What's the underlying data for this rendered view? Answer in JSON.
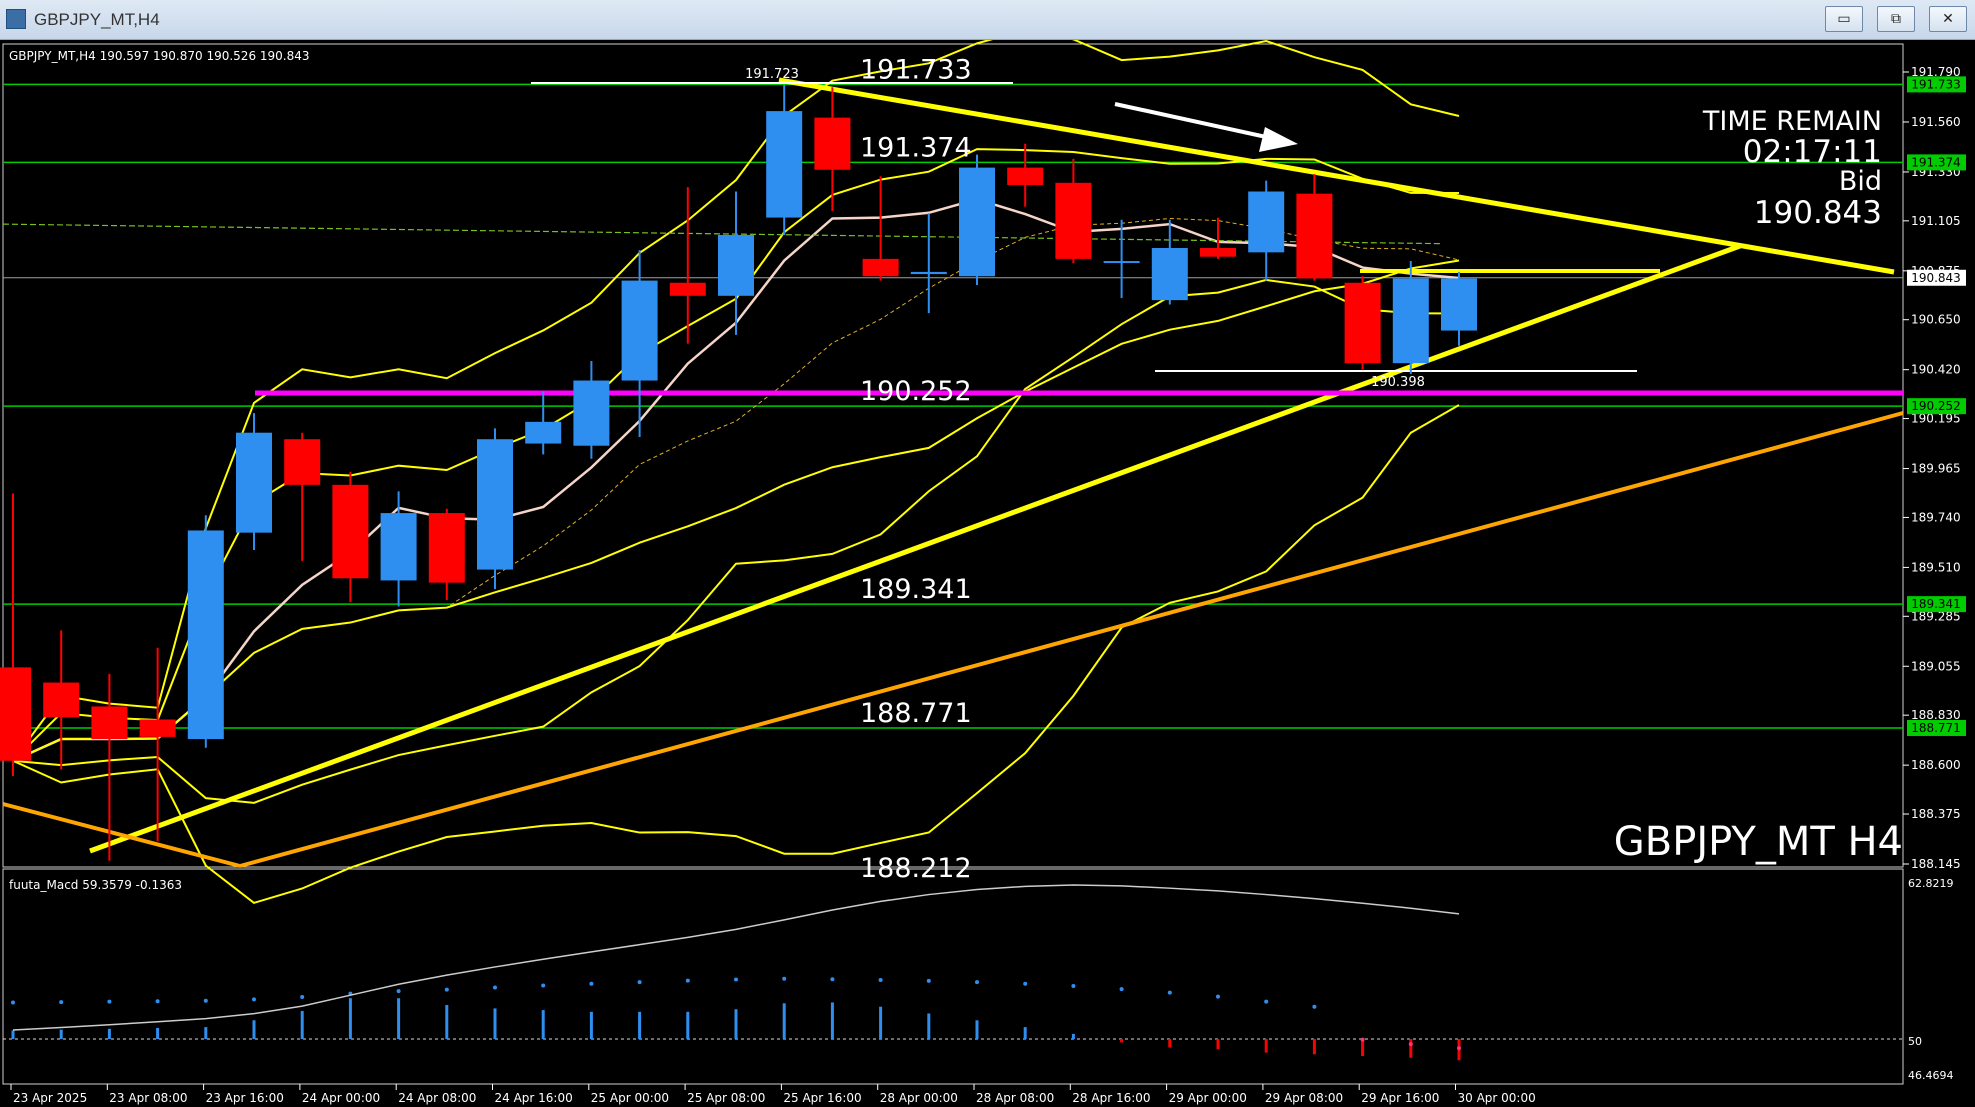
{
  "window": {
    "title": "GBPJPY_MT,H4",
    "buttons": {
      "minimize": "▭",
      "restore": "⧉",
      "close": "✕"
    }
  },
  "chart_info": {
    "header": "GBPJPY_MT,H4  190.597 190.870 190.526 190.843",
    "symbol_label": "GBPJPY_MT H4",
    "time_remain_label": "TIME REMAIN",
    "time_remain_value": "02:17:11",
    "bid_label": "Bid",
    "bid_value": "190.843"
  },
  "colors": {
    "background": "#000000",
    "bull": "#2e8ff0",
    "bear": "#ff0000",
    "trendline": "#ffff00",
    "hline": "#00cc00",
    "magenta": "#ff00ff",
    "orange": "#ffa500"
  },
  "price_axis": {
    "ticks": [
      "191.790",
      "191.560",
      "191.330",
      "191.105",
      "190.875",
      "190.650",
      "190.420",
      "190.195",
      "189.965",
      "189.740",
      "189.510",
      "189.285",
      "189.055",
      "188.830",
      "188.600",
      "188.375",
      "188.145"
    ],
    "labels": [
      {
        "text": "191.733",
        "color": "#00cc00"
      },
      {
        "text": "191.374",
        "color": "#00cc00"
      },
      {
        "text": "190.843",
        "color": "#ffffff"
      },
      {
        "text": "190.252",
        "color": "#00cc00"
      },
      {
        "text": "189.341",
        "color": "#00cc00"
      },
      {
        "text": "188.771",
        "color": "#00cc00"
      }
    ]
  },
  "level_labels": [
    {
      "text": "191.733",
      "price": 191.733
    },
    {
      "text": "191.374",
      "price": 191.374
    },
    {
      "text": "190.252",
      "price": 190.252
    },
    {
      "text": "189.341",
      "price": 189.341
    },
    {
      "text": "188.771",
      "price": 188.771
    }
  ],
  "small_labels": [
    {
      "text": "191.723"
    },
    {
      "text": "190.398"
    }
  ],
  "annotation_texts": {
    "partial_level": "188.212"
  },
  "candles": [
    {
      "o": 189.05,
      "h": 189.85,
      "l": 188.55,
      "c": 188.62
    },
    {
      "o": 188.98,
      "h": 189.22,
      "l": 188.58,
      "c": 188.82
    },
    {
      "o": 188.87,
      "h": 189.02,
      "l": 188.16,
      "c": 188.72
    },
    {
      "o": 188.81,
      "h": 189.14,
      "l": 188.25,
      "c": 188.73
    },
    {
      "o": 188.72,
      "h": 189.75,
      "l": 188.68,
      "c": 189.68
    },
    {
      "o": 189.67,
      "h": 190.22,
      "l": 189.59,
      "c": 190.13
    },
    {
      "o": 190.1,
      "h": 190.13,
      "l": 189.54,
      "c": 189.89
    },
    {
      "o": 189.89,
      "h": 189.95,
      "l": 189.35,
      "c": 189.46
    },
    {
      "o": 189.45,
      "h": 189.86,
      "l": 189.33,
      "c": 189.76
    },
    {
      "o": 189.76,
      "h": 189.78,
      "l": 189.36,
      "c": 189.44
    },
    {
      "o": 189.5,
      "h": 190.15,
      "l": 189.41,
      "c": 190.1
    },
    {
      "o": 190.08,
      "h": 190.32,
      "l": 190.03,
      "c": 190.18
    },
    {
      "o": 190.07,
      "h": 190.46,
      "l": 190.01,
      "c": 190.37
    },
    {
      "o": 190.37,
      "h": 190.97,
      "l": 190.11,
      "c": 190.83
    },
    {
      "o": 190.82,
      "h": 191.26,
      "l": 190.54,
      "c": 190.76
    },
    {
      "o": 190.76,
      "h": 191.24,
      "l": 190.58,
      "c": 191.04
    },
    {
      "o": 191.12,
      "h": 191.73,
      "l": 191.04,
      "c": 191.61
    },
    {
      "o": 191.58,
      "h": 191.72,
      "l": 191.15,
      "c": 191.34
    },
    {
      "o": 190.93,
      "h": 191.31,
      "l": 190.83,
      "c": 190.85
    },
    {
      "o": 190.86,
      "h": 191.14,
      "l": 190.68,
      "c": 190.87
    },
    {
      "o": 190.85,
      "h": 191.41,
      "l": 190.81,
      "c": 191.35
    },
    {
      "o": 191.35,
      "h": 191.46,
      "l": 191.17,
      "c": 191.27
    },
    {
      "o": 191.28,
      "h": 191.39,
      "l": 190.91,
      "c": 190.93
    },
    {
      "o": 190.92,
      "h": 191.11,
      "l": 190.75,
      "c": 190.92
    },
    {
      "o": 190.74,
      "h": 191.11,
      "l": 190.72,
      "c": 190.98
    },
    {
      "o": 190.98,
      "h": 191.12,
      "l": 190.93,
      "c": 190.94
    },
    {
      "o": 190.96,
      "h": 191.29,
      "l": 190.83,
      "c": 191.24
    },
    {
      "o": 191.23,
      "h": 191.32,
      "l": 190.83,
      "c": 190.84
    },
    {
      "o": 190.82,
      "h": 190.85,
      "l": 190.42,
      "c": 190.45
    },
    {
      "o": 190.45,
      "h": 190.92,
      "l": 190.4,
      "c": 190.84
    },
    {
      "o": 190.6,
      "h": 190.87,
      "l": 190.53,
      "c": 190.84
    }
  ],
  "indicator": {
    "label": "fuuta_Macd 59.3579  -0.1363",
    "scale_top": "62.8219",
    "scale_mid": "50",
    "scale_bottom": "46.4694",
    "histogram": [
      0.1,
      0.11,
      0.12,
      0.13,
      0.14,
      0.22,
      0.33,
      0.48,
      0.48,
      0.4,
      0.36,
      0.34,
      0.32,
      0.32,
      0.32,
      0.35,
      0.42,
      0.43,
      0.38,
      0.3,
      0.22,
      0.14,
      0.06,
      -0.04,
      -0.1,
      -0.12,
      -0.16,
      -0.18,
      -0.2,
      -0.22,
      -0.25
    ]
  },
  "time_axis": [
    "23 Apr 2025",
    "23 Apr 08:00",
    "23 Apr 16:00",
    "24 Apr 00:00",
    "24 Apr 08:00",
    "24 Apr 16:00",
    "25 Apr 00:00",
    "25 Apr 08:00",
    "25 Apr 16:00",
    "28 Apr 00:00",
    "28 Apr 08:00",
    "28 Apr 16:00",
    "29 Apr 00:00",
    "29 Apr 08:00",
    "29 Apr 16:00",
    "30 Apr 00:00"
  ]
}
